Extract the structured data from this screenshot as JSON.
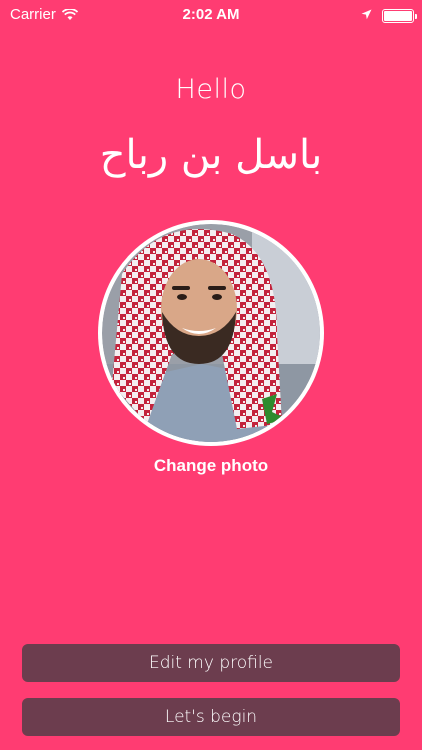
{
  "status_bar": {
    "carrier": "Carrier",
    "time": "2:02 AM",
    "icons": [
      "wifi-icon",
      "location-arrow-icon",
      "battery-icon"
    ],
    "battery_level": 1.0
  },
  "main": {
    "greeting": "Hello",
    "user_name": "باسل بن رباح",
    "avatar_icon": "profile-photo",
    "change_photo_label": "Change photo"
  },
  "actions": {
    "edit_profile_label": "Edit my profile",
    "lets_begin_label": "Let's begin"
  },
  "colors": {
    "background": "#FF3C72",
    "button_bg": "#6C3D4E",
    "text": "#FFFFFF"
  }
}
